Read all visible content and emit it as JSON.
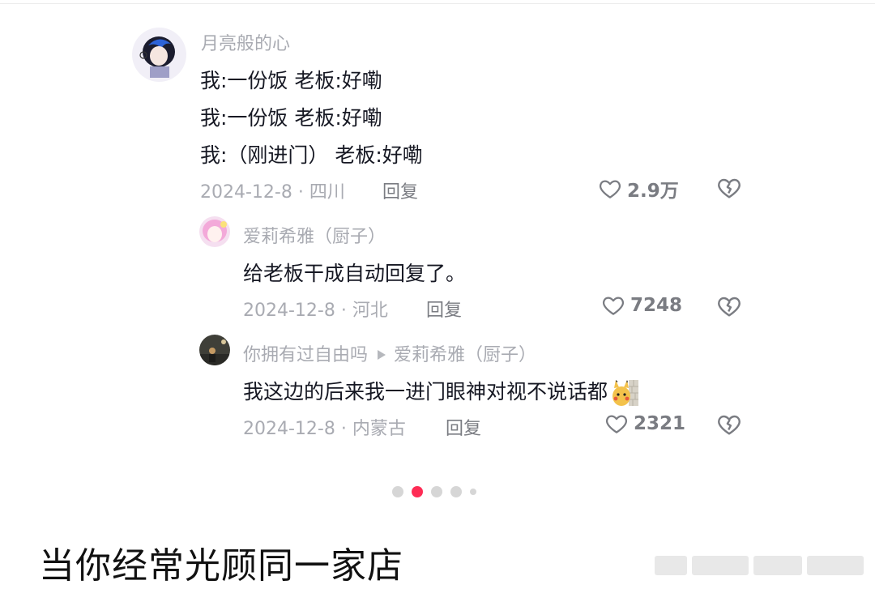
{
  "comment": {
    "username": "月亮般的心",
    "lines": [
      "我:一份饭   老板:好嘞",
      "我:一份饭   老板:好嘞",
      "我:（刚进门） 老板:好嘞"
    ],
    "date_loc": "2024-12-8 · 四川",
    "reply_label": "回复",
    "likes": "2.9万"
  },
  "replies": [
    {
      "username": "爱莉希雅（厨子）",
      "text": "给老板干成自动回复了。",
      "date_loc": "2024-12-8 · 河北",
      "reply_label": "回复",
      "likes": "7248"
    },
    {
      "username": "你拥有过自由吗",
      "reply_to": "爱莉希雅（厨子）",
      "text": "我这边的后来我一进门眼神对视不说话都",
      "emoji": "pikachu-wall-emoji",
      "date_loc": "2024-12-8 · 内蒙古",
      "reply_label": "回复",
      "likes": "2321"
    }
  ],
  "carousel": {
    "count": 5,
    "active_index": 1
  },
  "post_title": "当你经常光顾同一家店",
  "colors": {
    "accent": "#fe2c55",
    "muted": "#a9abb2",
    "text": "#161823"
  },
  "icons": [
    "heart-outline-icon",
    "dislike-heart-icon"
  ]
}
